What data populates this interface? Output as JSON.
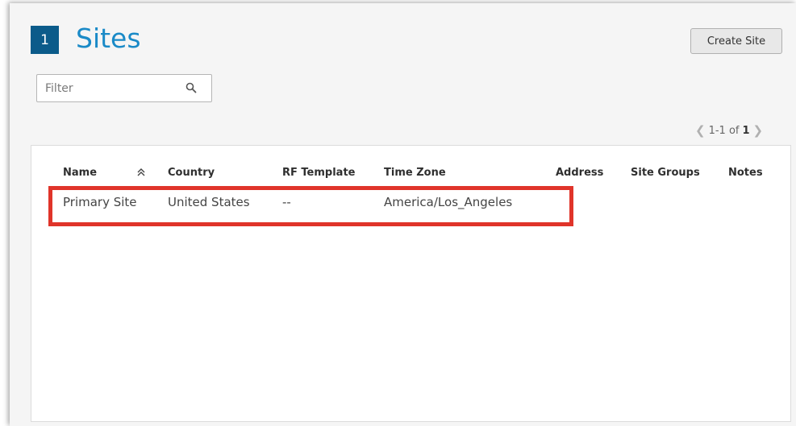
{
  "header": {
    "step_number": "1",
    "title": "Sites",
    "create_label": "Create Site"
  },
  "filter": {
    "placeholder": "Filter",
    "value": ""
  },
  "pagination": {
    "range": "1-1 of",
    "total": "1"
  },
  "table": {
    "columns": [
      "Name",
      "Country",
      "RF Template",
      "Time Zone",
      "Address",
      "Site Groups",
      "Notes"
    ],
    "rows": [
      {
        "name": "Primary Site",
        "country": "United States",
        "rf_template": "--",
        "time_zone": "America/Los_Angeles",
        "address": "",
        "site_groups": "",
        "notes": ""
      }
    ]
  },
  "colors": {
    "brand_blue": "#1a8ac7",
    "badge_blue": "#0b5b8a",
    "highlight_red": "#e0342a"
  },
  "icons": {
    "search": "search-icon",
    "sort": "sort-ascending-icon",
    "prev": "chevron-left-icon",
    "next": "chevron-right-icon"
  }
}
